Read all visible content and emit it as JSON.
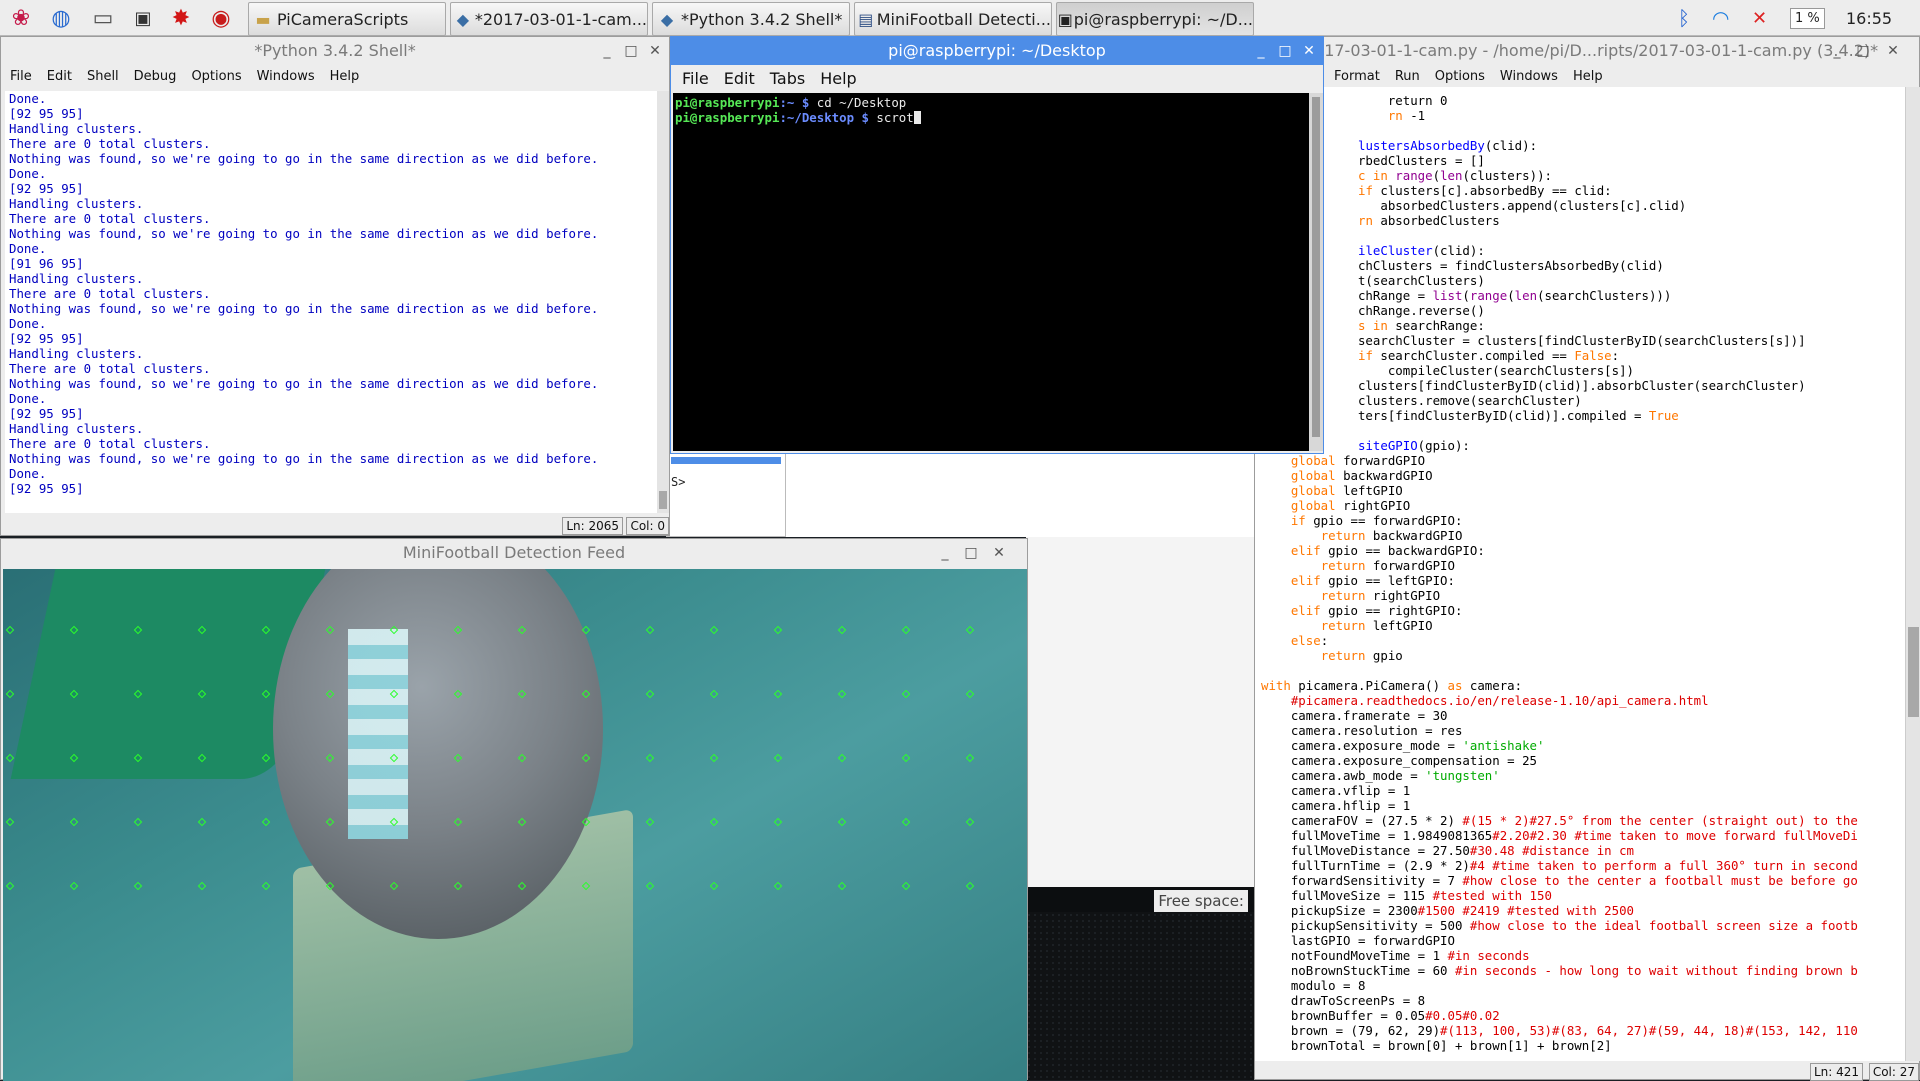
{
  "taskbar": {
    "tasks": [
      {
        "label": "PiCameraScripts",
        "icon": "folder-icon"
      },
      {
        "label": "*2017-03-01-1-cam...",
        "icon": "python-icon"
      },
      {
        "label": "*Python 3.4.2 Shell*",
        "icon": "python-icon"
      },
      {
        "label": "MiniFootball Detecti...",
        "icon": "window-icon"
      },
      {
        "label": "pi@raspberrypi: ~/D...",
        "icon": "terminal-icon"
      }
    ],
    "cpu": "1 %",
    "clock": "16:55"
  },
  "shell": {
    "title": "*Python 3.4.2 Shell*",
    "menu": [
      "File",
      "Edit",
      "Shell",
      "Debug",
      "Options",
      "Windows",
      "Help"
    ],
    "lines": [
      "Done.",
      "[92 95 95]",
      "Handling clusters.",
      "There are 0 total clusters.",
      "Nothing was found, so we're going to go in the same direction as we did before.",
      "Done.",
      "[92 95 95]",
      "Handling clusters.",
      "There are 0 total clusters.",
      "Nothing was found, so we're going to go in the same direction as we did before.",
      "Done.",
      "[91 96 95]",
      "Handling clusters.",
      "There are 0 total clusters.",
      "Nothing was found, so we're going to go in the same direction as we did before.",
      "Done.",
      "[92 95 95]",
      "Handling clusters.",
      "There are 0 total clusters.",
      "Nothing was found, so we're going to go in the same direction as we did before.",
      "Done.",
      "[92 95 95]",
      "Handling clusters.",
      "There are 0 total clusters.",
      "Nothing was found, so we're going to go in the same direction as we did before.",
      "Done.",
      "[92 95 95]"
    ],
    "ln": "Ln: 2065",
    "col": "Col: 0"
  },
  "terminal": {
    "title": "pi@raspberrypi: ~/Desktop",
    "menu": [
      "File",
      "Edit",
      "Tabs",
      "Help"
    ],
    "lines": [
      {
        "user": "pi@raspberrypi",
        "path": ":~ $",
        "cmd": " cd ~/Desktop"
      },
      {
        "user": "pi@raspberrypi",
        "path": ":~/Desktop $",
        "cmd": " scrot"
      }
    ]
  },
  "editor": {
    "title": "*2017-03-01-1-cam.py - /home/pi/D...ripts/2017-03-01-1-cam.py (3.4.2)*",
    "menu": [
      "Format",
      "Run",
      "Options",
      "Windows",
      "Help"
    ],
    "ln": "Ln: 421",
    "col": "Col: 27"
  },
  "feed": {
    "title": "MiniFootball Detection Feed"
  },
  "behind": {
    "prompt": "S>",
    "free_space": "Free space:"
  },
  "colors": {
    "accent": "#4d8de7",
    "shell_text": "#0000c0",
    "grid_marker": "#2bff2b"
  }
}
